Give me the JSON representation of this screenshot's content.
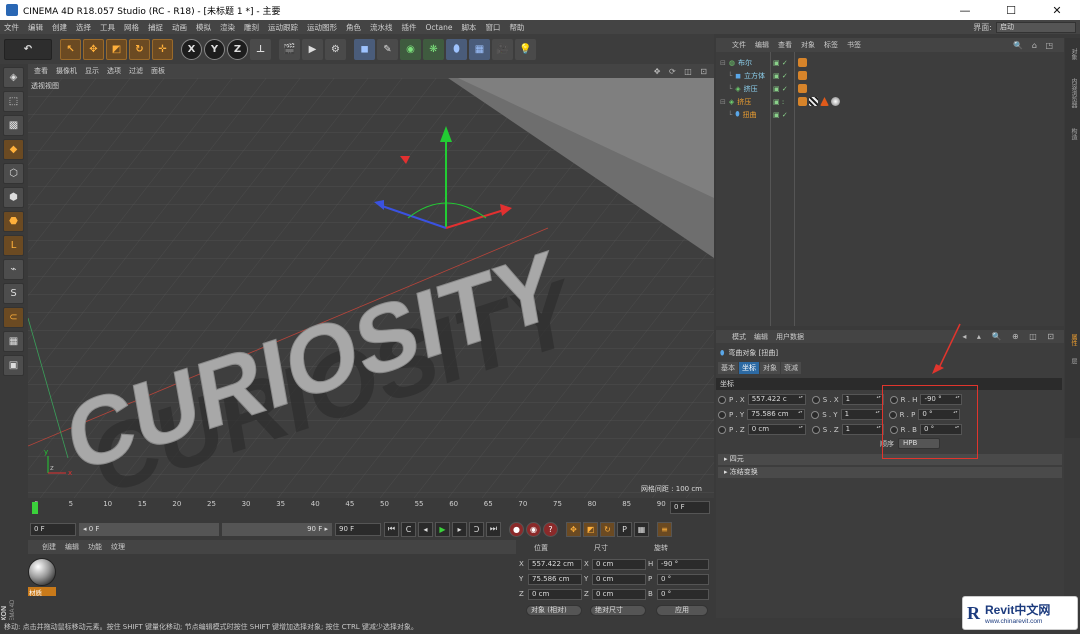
{
  "window": {
    "title": "CINEMA 4D R18.057 Studio (RC - R18) - [未标题 1 *] - 主要",
    "min": "—",
    "max": "☐",
    "close": "✕"
  },
  "menubar": {
    "items": [
      "文件",
      "编辑",
      "创建",
      "选择",
      "工具",
      "网格",
      "捕捉",
      "动画",
      "模拟",
      "渲染",
      "雕刻",
      "运动跟踪",
      "运动图形",
      "角色",
      "流水线",
      "插件",
      "Octane",
      "脚本",
      "窗口",
      "帮助"
    ],
    "layout_label": "界面:",
    "layout_value": "启动"
  },
  "toolbar": {
    "undo": "↶",
    "axes": [
      "X",
      "Y",
      "Z"
    ]
  },
  "viewport": {
    "menu": [
      "查看",
      "摄像机",
      "显示",
      "选项",
      "过滤",
      "面板"
    ],
    "label": "透视视图",
    "grid_info": "网格间距 : 100 cm",
    "text_3d": "CURIOSITY",
    "icons": "✥ ⟳ ◫ ⊡"
  },
  "timeline": {
    "ticks": [
      "0",
      "5",
      "10",
      "15",
      "20",
      "25",
      "30",
      "35",
      "40",
      "45",
      "50",
      "55",
      "60",
      "65",
      "70",
      "75",
      "80",
      "85",
      "90"
    ],
    "current_frame": "0 F"
  },
  "transport": {
    "start": "0 F",
    "range_start": "◂ 0 F",
    "range_end": "90 F ▸",
    "end": "90 F"
  },
  "material_manager": {
    "menu": [
      "创建",
      "编辑",
      "功能",
      "纹理"
    ],
    "material_name": "材质"
  },
  "coordinates": {
    "headers": [
      "位置",
      "尺寸",
      "旋转"
    ],
    "rows": [
      {
        "axis": "X",
        "pos": "557.422 cm",
        "size_axis": "X",
        "size": "0 cm",
        "rot_axis": "H",
        "rot": "-90 °"
      },
      {
        "axis": "Y",
        "pos": "75.586 cm",
        "size_axis": "Y",
        "size": "0 cm",
        "rot_axis": "P",
        "rot": "0 °"
      },
      {
        "axis": "Z",
        "pos": "0 cm",
        "size_axis": "Z",
        "size": "0 cm",
        "rot_axis": "B",
        "rot": "0 °"
      }
    ],
    "mode_select": "对象 (相对)",
    "size_select": "绝对尺寸",
    "apply": "应用"
  },
  "object_manager": {
    "menu": [
      "文件",
      "编辑",
      "查看",
      "对象",
      "标签",
      "书签"
    ],
    "icons": "🔍 ⌂ ◳",
    "objects": [
      {
        "name": "布尔",
        "indent": 0,
        "selected": false
      },
      {
        "name": "立方体",
        "indent": 1,
        "selected": false
      },
      {
        "name": "挤压",
        "indent": 1,
        "selected": false
      },
      {
        "name": "挤压",
        "indent": 0,
        "selected": true
      },
      {
        "name": "扭曲",
        "indent": 1,
        "selected": true
      }
    ]
  },
  "attribute_manager": {
    "menu": [
      "模式",
      "编辑",
      "用户数据"
    ],
    "icons": "◂ ▴ 🔍 ⊕ ◫ ⊡",
    "object_title": "弯曲对象 [扭曲]",
    "tabs": [
      "基本",
      "坐标",
      "对象",
      "衰减"
    ],
    "active_tab": "坐标",
    "section": "坐标",
    "rows": [
      {
        "p": "P . X",
        "pv": "557.422 c",
        "s": "S . X",
        "sv": "1",
        "r": "R . H",
        "rv": "-90 °"
      },
      {
        "p": "P . Y",
        "pv": "75.586 cm",
        "s": "S . Y",
        "sv": "1",
        "r": "R . P",
        "rv": "0 °"
      },
      {
        "p": "P . Z",
        "pv": "0 cm",
        "s": "S . Z",
        "sv": "1",
        "r": "R . B",
        "rv": "0 °"
      }
    ],
    "order_label": "顺序",
    "order_value": "HPB",
    "collapsed": [
      "四元",
      "冻结变换"
    ]
  },
  "right_tabs": [
    "对象",
    "内容浏览器",
    "构造",
    "属性",
    "层"
  ],
  "status": "移动: 点击并拖动鼠标移动元素。按住 SHIFT 键量化移动; 节点编辑模式时按住 SHIFT 键增加选择对象; 按住 CTRL 键减少选择对象。",
  "watermark": {
    "brand": "Revit中文网",
    "url": "www.chinarevit.com",
    "logo": "R"
  },
  "maxon": {
    "brand": "MAXON",
    "product": "CINEMA 4D"
  },
  "colors": {
    "accent_orange": "#f0a030",
    "selection_blue": "#2d6aa3",
    "annotation_red": "#e0352d"
  }
}
